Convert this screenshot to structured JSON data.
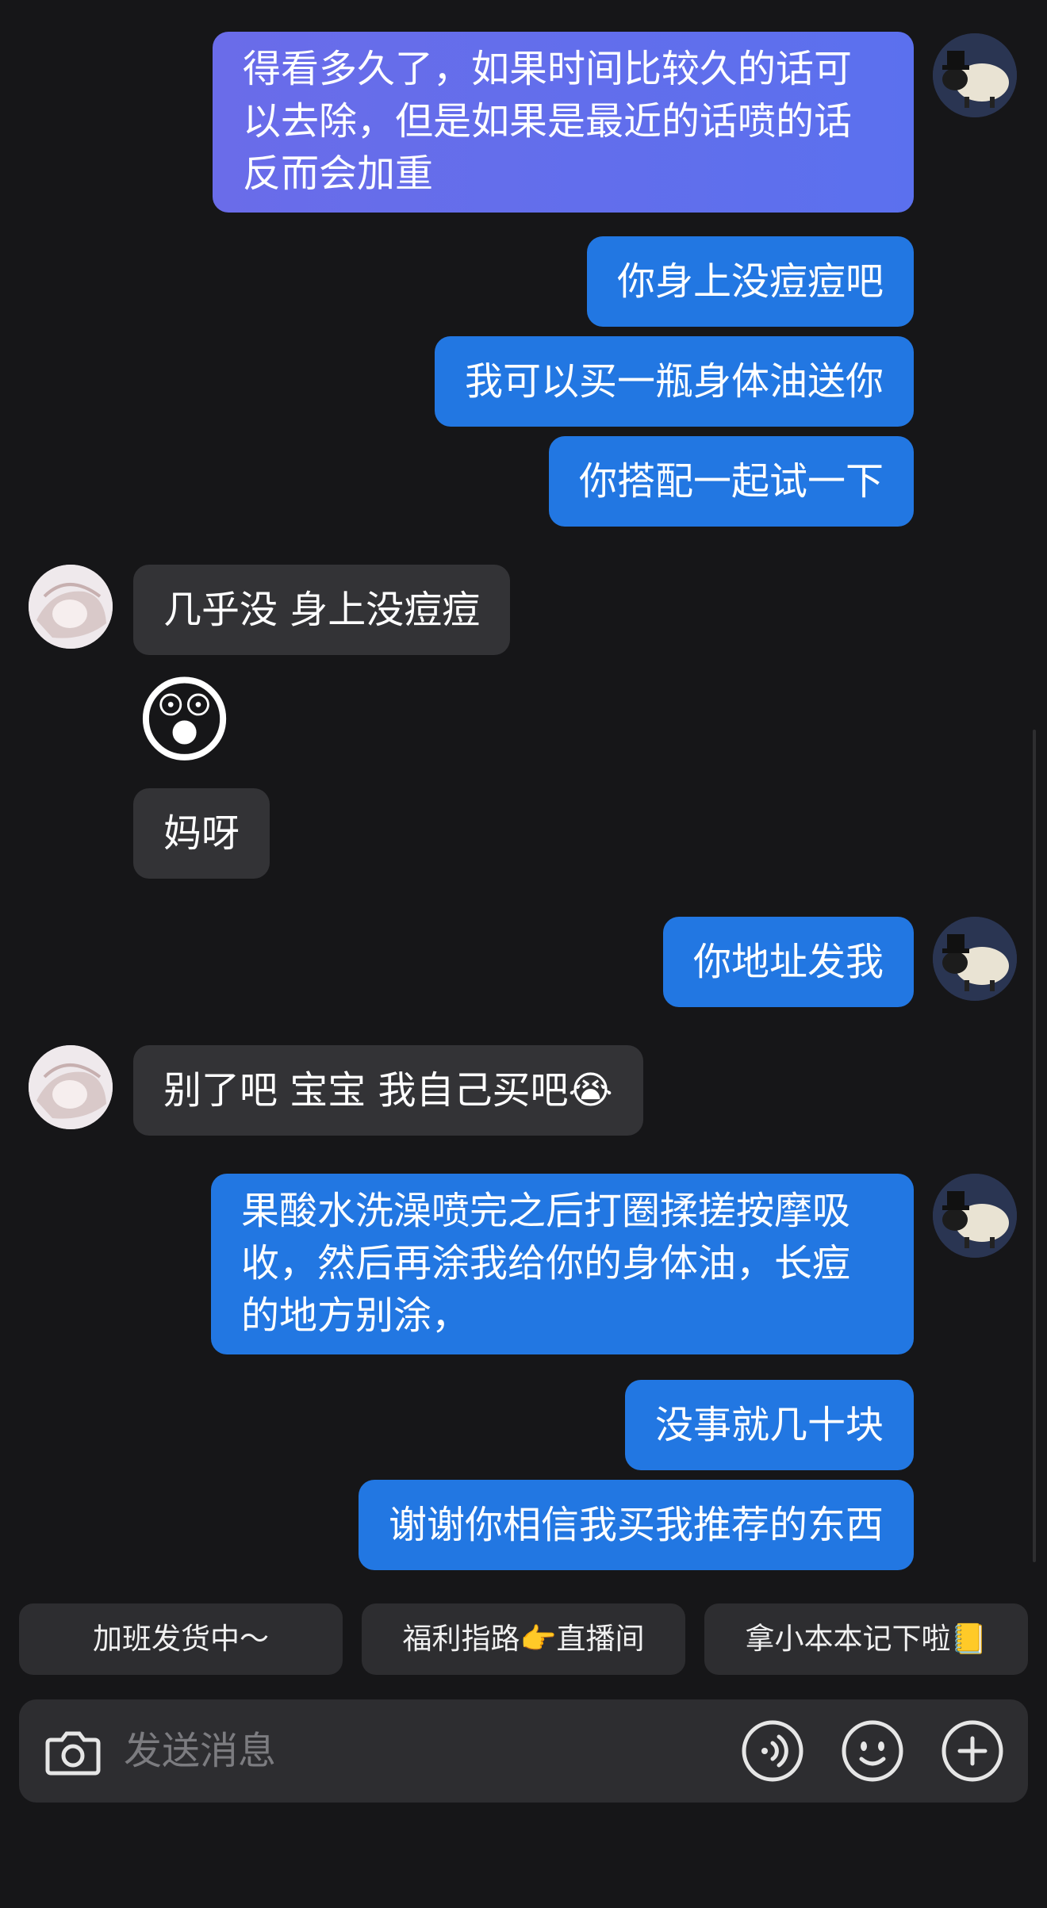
{
  "messages": {
    "m1": "得看多久了，如果时间比较久的话可以去除，但是如果是最近的话喷的话反而会加重",
    "m2": "你身上没痘痘吧",
    "m3": "我可以买一瓶身体油送你",
    "m4": "你搭配一起试一下",
    "m5": "几乎没 身上没痘痘",
    "m6_emoji": "😲",
    "m7": "妈呀",
    "m8": "你地址发我",
    "m9": "别了吧 宝宝 我自己买吧😭",
    "m10": "果酸水洗澡喷完之后打圈揉搓按摩吸收，然后再涂我给你的身体油，长痘的地方别涂，",
    "m11": "没事就几十块",
    "m12": "谢谢你相信我买我推荐的东西"
  },
  "quick_replies": [
    "加班发货中～",
    "福利指路👉直播间",
    "拿小本本记下啦📒"
  ],
  "input": {
    "placeholder": "发送消息"
  },
  "icons": {
    "camera": "camera-icon",
    "voice": "voice-icon",
    "emoji": "emoji-icon",
    "add": "add-icon"
  },
  "colors": {
    "background": "#161618",
    "my_bubble": "#2277e2",
    "their_bubble": "#333336",
    "input_bg": "#2d2d30"
  }
}
